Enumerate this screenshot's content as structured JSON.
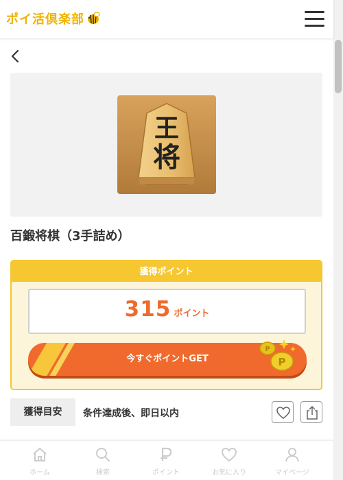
{
  "header": {
    "logo_text": "ポイ活倶楽部",
    "brand_color": "#f0b300"
  },
  "icons": {
    "menu": "hamburger-icon",
    "back": "chevron-left-icon",
    "favorite": "heart-icon",
    "share": "share-icon"
  },
  "offer": {
    "app_icon": "shogi-king-piece-icon",
    "icon_text_top": "王",
    "icon_text_bottom": "将",
    "title": "百鍛将棋（3手詰め）"
  },
  "points": {
    "header_label": "獲得ポイント",
    "value": "315",
    "unit": "ポイント",
    "cta_label": "今すぐポイントGET",
    "accent_color": "#ee6b2c",
    "card_color": "#f5c731"
  },
  "estimate": {
    "label": "獲得目安",
    "value": "条件達成後、即日以内"
  },
  "bottom_nav": {
    "items": [
      {
        "label": "ホーム",
        "icon": "home-icon"
      },
      {
        "label": "検索",
        "icon": "search-icon"
      },
      {
        "label": "ポイント",
        "icon": "point-p-icon"
      },
      {
        "label": "お気に入り",
        "icon": "heart-icon"
      },
      {
        "label": "マイページ",
        "icon": "user-icon"
      }
    ]
  }
}
